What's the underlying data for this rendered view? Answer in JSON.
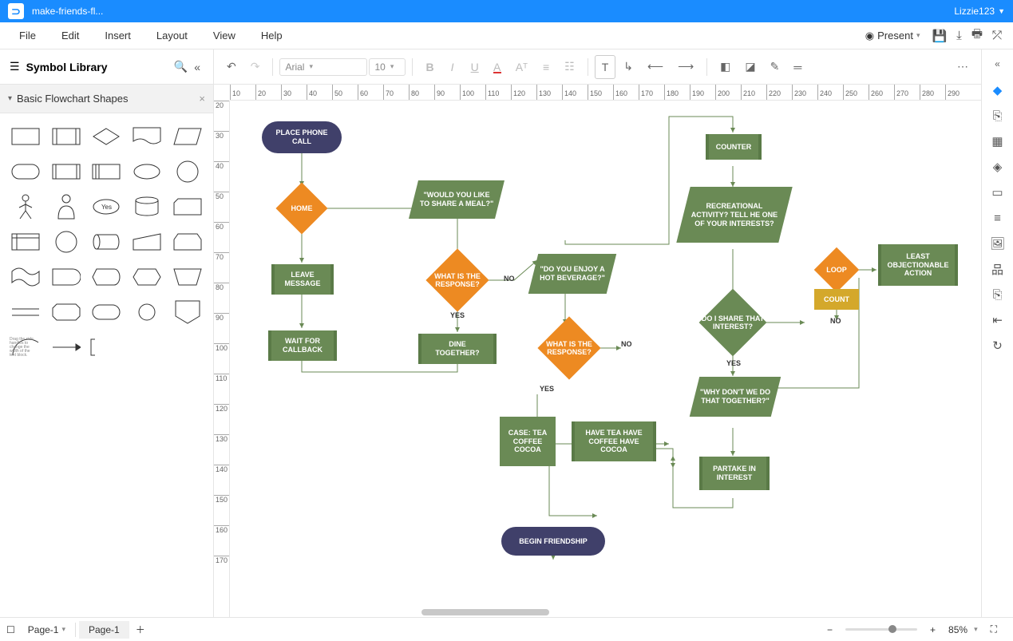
{
  "titlebar": {
    "doc_name": "make-friends-fl...",
    "user": "Lizzie123"
  },
  "menubar": {
    "file": "File",
    "edit": "Edit",
    "insert": "Insert",
    "layout": "Layout",
    "view": "View",
    "help": "Help",
    "present": "Present"
  },
  "left_panel": {
    "title": "Symbol Library",
    "section": "Basic Flowchart Shapes",
    "yes_shape_label": "Yes",
    "annotation_hint": "Drag the side handles to change the width of the text block."
  },
  "toolbar": {
    "font": "Arial",
    "size": "10"
  },
  "ruler_h": [
    "10",
    "20",
    "30",
    "40",
    "50",
    "60",
    "70",
    "80",
    "90",
    "100",
    "110",
    "120",
    "130",
    "140",
    "150",
    "160",
    "170",
    "180",
    "190",
    "200",
    "210",
    "220",
    "230",
    "240",
    "250",
    "260",
    "270",
    "280",
    "290"
  ],
  "ruler_v": [
    "20",
    "30",
    "40",
    "50",
    "60",
    "70",
    "80",
    "90",
    "100",
    "110",
    "120",
    "130",
    "140",
    "150",
    "160",
    "170"
  ],
  "footer": {
    "page_select": "Page-1",
    "page_tab": "Page-1",
    "zoom": "85%"
  },
  "flow": {
    "place_call": "PLACE PHONE CALL",
    "home": "HOME",
    "leave_msg": "LEAVE MESSAGE",
    "wait_callback": "WAIT FOR CALLBACK",
    "share_meal": "\"WOULD YOU LIKE TO SHARE A MEAL?\"",
    "resp1": "WHAT IS THE RESPONSE?",
    "dine": "DINE TOGETHER?",
    "hot_bev": "\"DO YOU ENJOY A HOT BEVERAGE?\"",
    "resp2": "WHAT IS THE RESPONSE?",
    "case": "CASE: TEA COFFEE COCOA",
    "have": "HAVE TEA HAVE COFFEE HAVE COCOA",
    "begin": "BEGIN FRIENDSHIP",
    "counter": "COUNTER",
    "rec_activity": "RECREATIONAL ACTIVITY? TELL HE ONE OF YOUR INTERESTS?",
    "share_interest": "DO I SHARE THAT INTEREST?",
    "why_together": "\"WHY DON'T WE DO THAT TOGETHER?\"",
    "partake": "PARTAKE IN INTEREST",
    "loop": "LOOP",
    "count": "COUNT",
    "least_obj": "LEAST OBJECTIONABLE ACTION",
    "yes": "YES",
    "no": "NO"
  }
}
